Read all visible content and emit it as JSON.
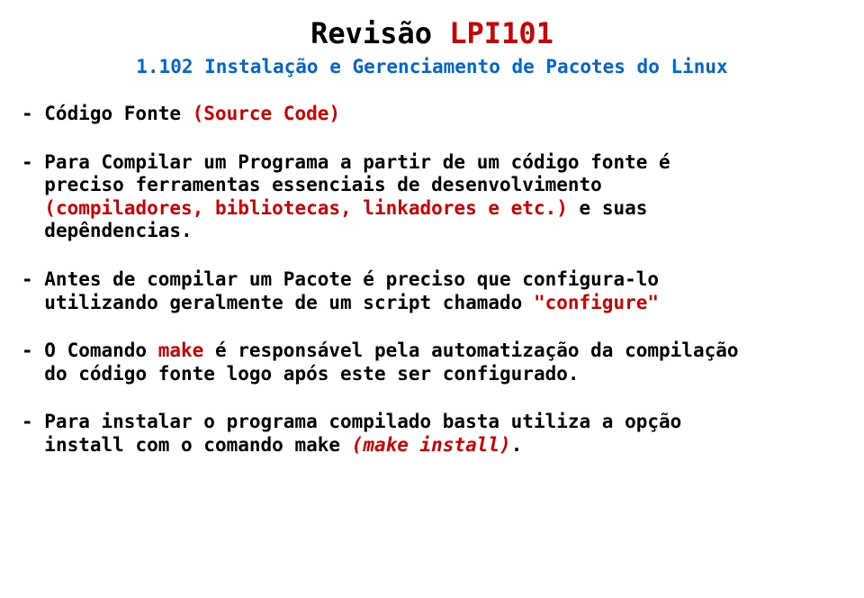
{
  "title": {
    "part1": "Revisão ",
    "part2": "LPI101"
  },
  "section": "1.102 Instalação e Gerenciamento de Pacotes do Linux",
  "p1_a": "- Código Fonte ",
  "p1_b": "(Source Code)",
  "p2_a": "- Para Compilar um Programa a partir de um código fonte é\n  preciso ferramentas essenciais de desenvolvimento\n  ",
  "p2_b": "(compiladores, bibliotecas, linkadores e etc.)",
  "p2_c": " e suas\n  depêndencias.",
  "p3_a": "- Antes de compilar um Pacote é preciso que configura-lo\n  utilizando geralmente de um script chamado ",
  "p3_b": "\"configure\"",
  "p4_a": "- O Comando ",
  "p4_b": "make",
  "p4_c": " é responsável pela automatização da compilação\n  do código fonte logo após este ser configurado.",
  "p5_a": "- Para instalar o programa compilado basta utiliza a opção\n  install com o comando make ",
  "p5_b": "(make install)",
  "p5_c": "."
}
